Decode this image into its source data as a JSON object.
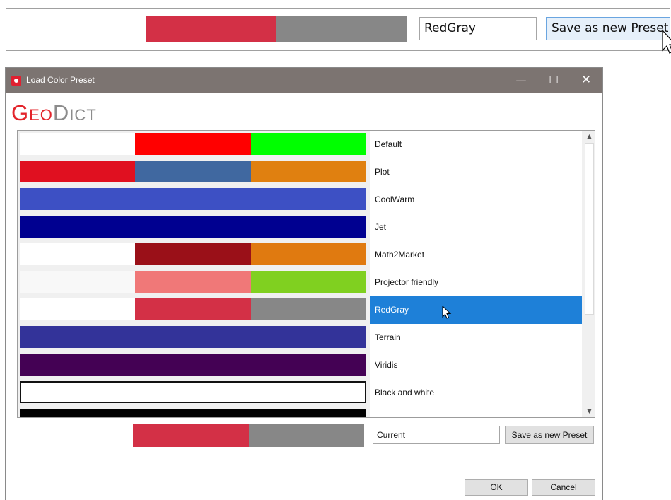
{
  "top_strip": {
    "swatch_colors": [
      "#ffffff",
      "#d33046",
      "#878787"
    ],
    "name_value": "RedGray",
    "save_label": "Save as new Preset"
  },
  "dialog": {
    "title": "Load Color Preset",
    "window_controls": {
      "minimize": "—",
      "maximize": "☐",
      "close": "✕"
    },
    "logo": {
      "geo_first": "G",
      "geo_rest": "EO",
      "dict_first": "D",
      "dict_rest": "ICT"
    },
    "presets": [
      {
        "name": "Default",
        "colors": [
          "#ffffff",
          "#ff0000",
          "#00ff00"
        ],
        "selected": false
      },
      {
        "name": "Plot",
        "colors": [
          "#e01020",
          "#4068a0",
          "#e08010"
        ],
        "selected": false
      },
      {
        "name": "CoolWarm",
        "colors": [
          "#3d50c4",
          "#3d50c4",
          "#3d50c4"
        ],
        "selected": false
      },
      {
        "name": "Jet",
        "colors": [
          "#000090",
          "#000090",
          "#000090"
        ],
        "selected": false
      },
      {
        "name": "Math2Market",
        "colors": [
          "#ffffff",
          "#9a1018",
          "#e07a10"
        ],
        "selected": false
      },
      {
        "name": "Projector friendly",
        "colors": [
          "#f8f8f8",
          "#f07878",
          "#80d020"
        ],
        "selected": false
      },
      {
        "name": "RedGray",
        "colors": [
          "#ffffff",
          "#d33046",
          "#878787"
        ],
        "selected": true
      },
      {
        "name": "Terrain",
        "colors": [
          "#333399",
          "#333399",
          "#333399"
        ],
        "selected": false
      },
      {
        "name": "Viridis",
        "colors": [
          "#440154",
          "#440154",
          "#440154"
        ],
        "selected": false
      },
      {
        "name": "Black and white",
        "colors": [
          "#ffffff",
          "#ffffff",
          "#ffffff"
        ],
        "selected": false,
        "bordered": true
      },
      {
        "name": "",
        "colors": [
          "#000000",
          "#000000",
          "#000000"
        ],
        "selected": false
      }
    ],
    "scrollbar": {
      "up": "▲",
      "down": "▼"
    },
    "current": {
      "swatch_colors": [
        "#ffffff",
        "#d33046",
        "#878787"
      ],
      "name_value": "Current",
      "save_label": "Save as new Preset"
    },
    "ok_label": "OK",
    "cancel_label": "Cancel"
  }
}
